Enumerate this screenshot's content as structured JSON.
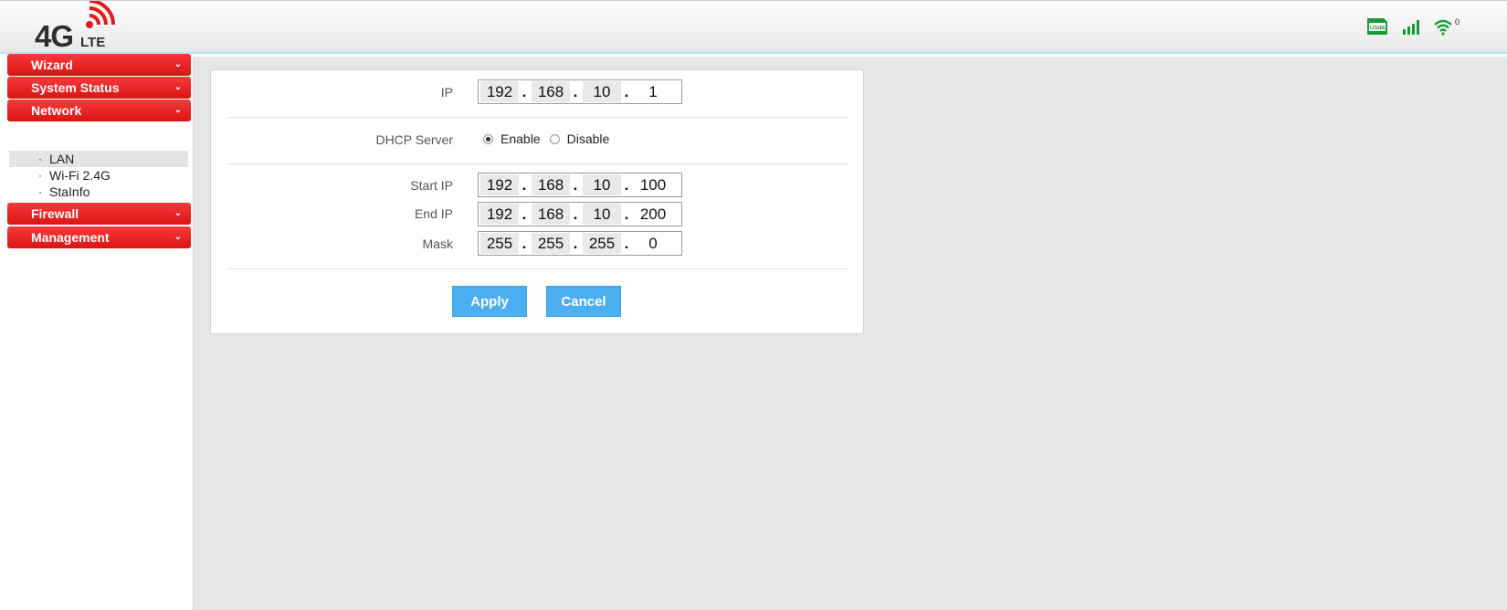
{
  "header": {
    "logo_main": "4G",
    "logo_sub": "LTE",
    "usim_label": "USIM",
    "wifi_clients": "0",
    "colors": {
      "brand_red": "#dc1414",
      "status_green": "#1a9b3a"
    }
  },
  "sidebar": {
    "groups": [
      {
        "label": "Wizard"
      },
      {
        "label": "System Status"
      },
      {
        "label": "Network"
      },
      {
        "label": "Firewall"
      },
      {
        "label": "Management"
      }
    ],
    "network_items": [
      {
        "label": "LAN",
        "active": true
      },
      {
        "label": "Wi-Fi 2.4G",
        "active": false
      },
      {
        "label": "StaInfo",
        "active": false
      }
    ],
    "bullet": "·",
    "chevron": "⌄"
  },
  "lan": {
    "ip_label": "IP",
    "ip": [
      "192",
      "168",
      "10",
      "1"
    ],
    "dhcp_label": "DHCP Server",
    "dhcp_enable": "Enable",
    "dhcp_disable": "Disable",
    "dhcp_selected": "Enable",
    "start_ip_label": "Start IP",
    "start_ip": [
      "192",
      "168",
      "10",
      "100"
    ],
    "end_ip_label": "End IP",
    "end_ip": [
      "192",
      "168",
      "10",
      "200"
    ],
    "mask_label": "Mask",
    "mask": [
      "255",
      "255",
      "255",
      "0"
    ],
    "ip_separator": ".",
    "apply_label": "Apply",
    "cancel_label": "Cancel"
  }
}
